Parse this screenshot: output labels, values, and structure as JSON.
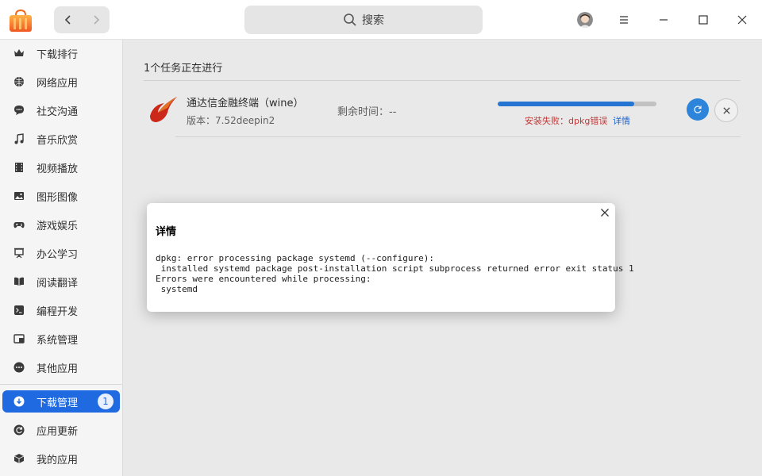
{
  "titlebar": {
    "search_label": "搜索"
  },
  "sidebar": {
    "items": [
      {
        "label": "下载排行",
        "icon": "crown-icon"
      },
      {
        "label": "网络应用",
        "icon": "globe-icon"
      },
      {
        "label": "社交沟通",
        "icon": "chat-icon"
      },
      {
        "label": "音乐欣赏",
        "icon": "music-icon"
      },
      {
        "label": "视频播放",
        "icon": "film-icon"
      },
      {
        "label": "图形图像",
        "icon": "image-icon"
      },
      {
        "label": "游戏娱乐",
        "icon": "gamepad-icon"
      },
      {
        "label": "办公学习",
        "icon": "presentation-icon"
      },
      {
        "label": "阅读翻译",
        "icon": "book-icon"
      },
      {
        "label": "编程开发",
        "icon": "terminal-icon"
      },
      {
        "label": "系统管理",
        "icon": "system-icon"
      },
      {
        "label": "其他应用",
        "icon": "more-icon"
      }
    ],
    "bottom_items": [
      {
        "label": "下载管理",
        "icon": "download-icon",
        "badge": "1",
        "active": true
      },
      {
        "label": "应用更新",
        "icon": "refresh-icon"
      },
      {
        "label": "我的应用",
        "icon": "box-icon"
      }
    ]
  },
  "main": {
    "task_count": "1个任务正在进行",
    "task": {
      "name": "通达信金融终端（wine）",
      "version": "版本：7.52deepin2",
      "remaining": "剩余时间：--",
      "progress": 0.86,
      "status": "安装失败：dpkg错误",
      "detail_link": "详情"
    }
  },
  "dialog": {
    "title": "详情",
    "log": "dpkg: error processing package systemd (--configure):\n installed systemd package post-installation script subprocess returned error exit status 1\nErrors were encountered while processing:\n systemd"
  },
  "colors": {
    "accent": "#1f6ae0",
    "progress": "#2a7de1",
    "error": "#d13b3b"
  }
}
